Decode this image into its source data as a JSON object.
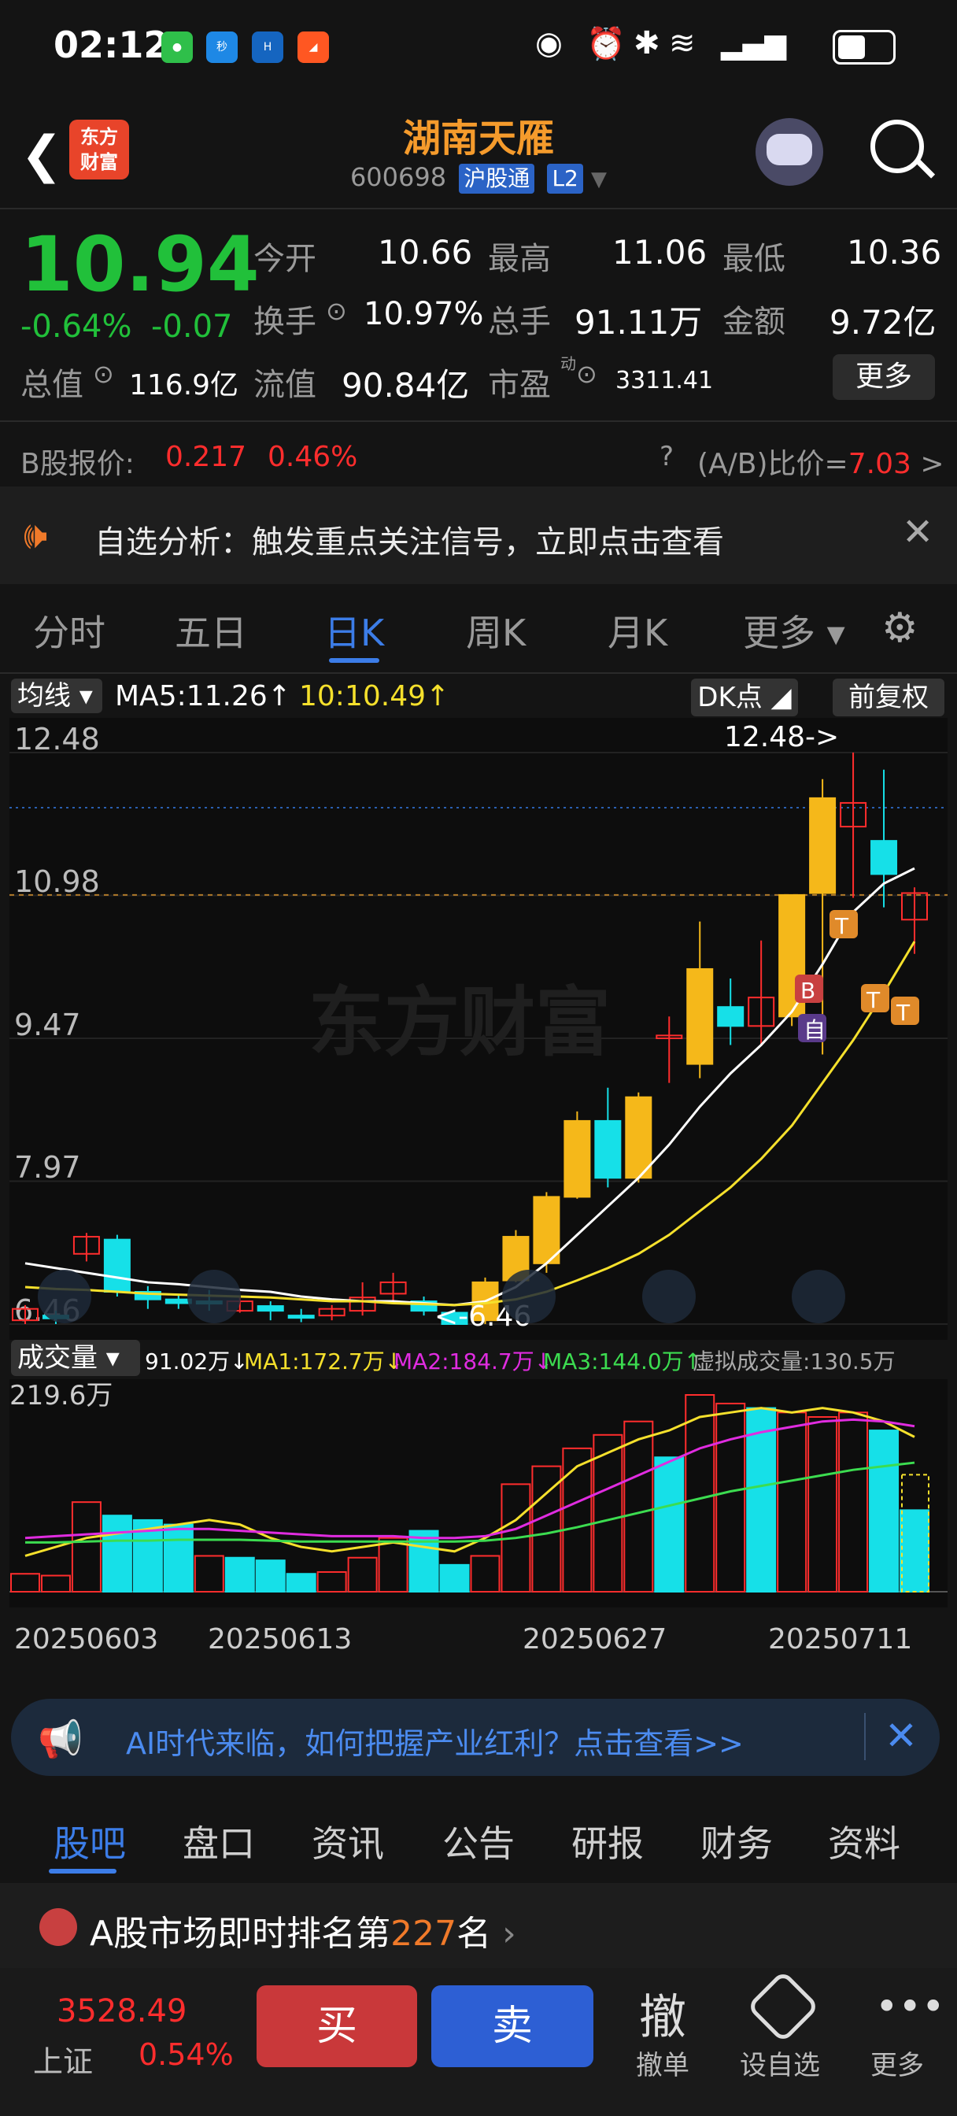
{
  "status": {
    "time": "02:12"
  },
  "header": {
    "title": "湖南天雁",
    "code": "600698",
    "tag1": "沪股通",
    "tag2": "L2",
    "logo_line1": "东方",
    "logo_line2": "财富"
  },
  "quote": {
    "price": "10.94",
    "change_pct": "-0.64%",
    "change": "-0.07",
    "open_label": "今开",
    "open": "10.66",
    "high_label": "最高",
    "high": "11.06",
    "low_label": "最低",
    "low": "10.36",
    "turnover_label": "换手",
    "turnover": "10.97%",
    "volume_label": "总手",
    "volume": "91.11万",
    "amount_label": "金额",
    "amount": "9.72亿",
    "mktcap_label": "总值",
    "mktcap": "116.9亿",
    "float_label": "流值",
    "float": "90.84亿",
    "pe_label": "市盈",
    "pe_sup": "动",
    "pe": "3311.41",
    "more": "更多",
    "b_label": "B股报价:",
    "b_price": "0.217",
    "b_pct": "0.46%",
    "ab_label": "(A/B)比价=",
    "ab_value": "7.03"
  },
  "alert": {
    "text": "自选分析：触发重点关注信号，立即点击查看"
  },
  "tabs": [
    "分时",
    "五日",
    "日K",
    "周K",
    "月K",
    "更多"
  ],
  "active_tab": "日K",
  "kline": {
    "indicator": "均线",
    "ma5": "MA5:11.26↑",
    "ma10": "10:10.49↑",
    "dk": "DK点",
    "adjust": "前复权",
    "y_labels": [
      "12.48",
      "10.98",
      "9.47",
      "7.97",
      "6.46"
    ],
    "high_note": "12.48->",
    "low_note": "<-6.46",
    "watermark": "东方财富",
    "markers": [
      "T",
      "T",
      "T",
      "B",
      "自"
    ]
  },
  "volume": {
    "indicator": "成交量",
    "vol": "91.02万↓",
    "ma1": "MA1:172.7万↓",
    "ma2": "MA2:184.7万↓",
    "ma3": "MA3:144.0万↑",
    "virtual": "虚拟成交量:130.5万",
    "max": "219.6万",
    "dates": [
      "20250603",
      "20250613",
      "20250627",
      "20250711"
    ]
  },
  "notice": {
    "text": "AI时代来临，如何把握产业红利？点击查看>>"
  },
  "bottom_tabs": [
    "股吧",
    "盘口",
    "资讯",
    "公告",
    "研报",
    "财务",
    "资料"
  ],
  "rank": {
    "prefix": "A股市场即时排名第",
    "num": "227",
    "suffix": "名"
  },
  "footer": {
    "index_value": "3528.49",
    "index_name": "上证",
    "index_pct": "0.54%",
    "buy": "买",
    "sell": "卖",
    "cancel_icon": "撤",
    "cancel": "撤单",
    "set_alert": "设自选",
    "more": "更多"
  },
  "chart_data": {
    "type": "candlestick",
    "ylim": [
      6.46,
      12.48
    ],
    "candles": [
      {
        "o": 6.5,
        "c": 6.62,
        "h": 6.66,
        "l": 6.46,
        "up": true
      },
      {
        "o": 6.55,
        "c": 6.52,
        "h": 6.6,
        "l": 6.46,
        "up": false
      },
      {
        "o": 7.2,
        "c": 7.38,
        "h": 7.42,
        "l": 7.12,
        "up": true
      },
      {
        "o": 7.35,
        "c": 6.8,
        "h": 7.4,
        "l": 6.75,
        "up": false
      },
      {
        "o": 6.8,
        "c": 6.72,
        "h": 6.86,
        "l": 6.62,
        "up": false
      },
      {
        "o": 6.72,
        "c": 6.68,
        "h": 6.78,
        "l": 6.62,
        "up": false
      },
      {
        "o": 6.7,
        "c": 6.7,
        "h": 6.82,
        "l": 6.6,
        "up": false
      },
      {
        "o": 6.6,
        "c": 6.7,
        "h": 6.76,
        "l": 6.58,
        "up": true
      },
      {
        "o": 6.65,
        "c": 6.6,
        "h": 6.7,
        "l": 6.5,
        "up": false
      },
      {
        "o": 6.55,
        "c": 6.55,
        "h": 6.62,
        "l": 6.48,
        "up": false
      },
      {
        "o": 6.55,
        "c": 6.62,
        "h": 6.66,
        "l": 6.5,
        "up": true
      },
      {
        "o": 6.6,
        "c": 6.74,
        "h": 6.9,
        "l": 6.55,
        "up": true
      },
      {
        "o": 6.78,
        "c": 6.9,
        "h": 7.0,
        "l": 6.7,
        "up": true
      },
      {
        "o": 6.7,
        "c": 6.6,
        "h": 6.75,
        "l": 6.55,
        "up": false
      },
      {
        "o": 6.58,
        "c": 6.46,
        "h": 6.6,
        "l": 6.46,
        "up": false
      },
      {
        "o": 6.5,
        "c": 6.9,
        "h": 6.95,
        "l": 6.46,
        "up": true
      },
      {
        "o": 6.92,
        "c": 7.38,
        "h": 7.45,
        "l": 6.9,
        "up": true
      },
      {
        "o": 7.1,
        "c": 7.8,
        "h": 7.85,
        "l": 7.0,
        "up": true
      },
      {
        "o": 7.8,
        "c": 8.6,
        "h": 8.7,
        "l": 7.78,
        "up": true
      },
      {
        "o": 8.6,
        "c": 8.0,
        "h": 8.95,
        "l": 7.9,
        "up": false
      },
      {
        "o": 8.0,
        "c": 8.85,
        "h": 8.9,
        "l": 7.95,
        "up": true
      },
      {
        "o": 9.47,
        "c": 9.5,
        "h": 9.7,
        "l": 9.0,
        "up": true
      },
      {
        "o": 9.2,
        "c": 10.2,
        "h": 10.7,
        "l": 9.05,
        "up": true
      },
      {
        "o": 9.8,
        "c": 9.6,
        "h": 10.1,
        "l": 9.4,
        "up": false
      },
      {
        "o": 9.6,
        "c": 9.9,
        "h": 10.5,
        "l": 9.4,
        "up": true
      },
      {
        "o": 9.7,
        "c": 10.98,
        "h": 10.98,
        "l": 9.6,
        "up": true
      },
      {
        "o": 11.0,
        "c": 12.0,
        "h": 12.2,
        "l": 9.3,
        "up": true
      },
      {
        "o": 11.95,
        "c": 11.7,
        "h": 12.48,
        "l": 10.95,
        "up": true
      },
      {
        "o": 11.55,
        "c": 11.2,
        "h": 12.3,
        "l": 10.85,
        "up": false
      },
      {
        "o": 11.0,
        "c": 10.72,
        "h": 11.06,
        "l": 10.36,
        "up": true
      }
    ],
    "ma5": [
      7.1,
      7.05,
      7.0,
      6.95,
      6.9,
      6.88,
      6.85,
      6.82,
      6.8,
      6.75,
      6.72,
      6.7,
      6.7,
      6.68,
      6.66,
      6.7,
      6.85,
      7.1,
      7.4,
      7.7,
      8.0,
      8.35,
      8.75,
      9.1,
      9.4,
      9.75,
      10.25,
      10.8,
      11.1,
      11.26
    ],
    "ma10": [
      6.85,
      6.83,
      6.82,
      6.8,
      6.78,
      6.77,
      6.76,
      6.75,
      6.74,
      6.72,
      6.7,
      6.7,
      6.68,
      6.67,
      6.66,
      6.68,
      6.72,
      6.8,
      6.92,
      7.05,
      7.2,
      7.4,
      7.65,
      7.9,
      8.2,
      8.55,
      9.0,
      9.45,
      9.95,
      10.49
    ],
    "volumes": [
      20,
      18,
      100,
      85,
      80,
      75,
      40,
      38,
      35,
      20,
      22,
      38,
      60,
      68,
      30,
      40,
      120,
      140,
      160,
      175,
      190,
      150,
      219.6,
      210,
      205,
      200,
      195,
      200,
      180,
      91.02
    ],
    "vol_up": [
      true,
      true,
      true,
      false,
      false,
      false,
      true,
      false,
      false,
      false,
      true,
      true,
      true,
      false,
      false,
      true,
      true,
      true,
      true,
      true,
      true,
      false,
      true,
      true,
      false,
      true,
      true,
      true,
      false,
      false
    ],
    "vol_ma1": [
      40,
      50,
      60,
      65,
      70,
      75,
      80,
      75,
      60,
      50,
      45,
      50,
      55,
      50,
      45,
      60,
      80,
      110,
      140,
      155,
      170,
      180,
      195,
      200,
      205,
      200,
      205,
      200,
      190,
      172.7
    ],
    "vol_ma2": [
      60,
      62,
      64,
      66,
      68,
      70,
      70,
      68,
      66,
      64,
      62,
      62,
      62,
      60,
      60,
      62,
      70,
      85,
      100,
      115,
      130,
      145,
      160,
      170,
      178,
      184,
      190,
      192,
      190,
      184.7
    ],
    "vol_ma3": [
      55,
      55,
      56,
      57,
      57,
      58,
      58,
      58,
      57,
      56,
      56,
      56,
      56,
      56,
      56,
      57,
      60,
      65,
      72,
      80,
      88,
      96,
      104,
      112,
      118,
      124,
      130,
      136,
      140,
      144.0
    ]
  }
}
